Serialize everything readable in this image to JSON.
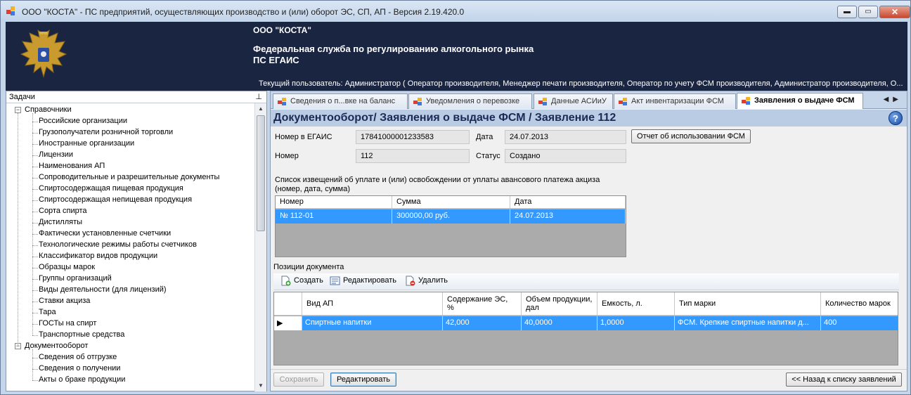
{
  "window": {
    "title": "ООО \"КОСТА\" - ПС предприятий, осуществляющих производство и (или) оборот ЭС, СП, АП - Версия 2.19.420.0",
    "minimize": "▬",
    "restore": "▭",
    "close": "✕"
  },
  "header": {
    "org": "ООО \"КОСТА\"",
    "federal": "Федеральная служба по регулированию алкогольного рынка",
    "system": "ПС ЕГАИС",
    "user": "Текущий пользователь: Администратор ( Оператор производителя, Менеджер печати производителя, Оператор по учету ФСМ производителя, Администратор производителя, О..."
  },
  "tasks": {
    "title": "Задачи",
    "pin": "⊥",
    "groups": [
      {
        "label": "Справочники",
        "expander": "−",
        "items": [
          "Российские организации",
          "Грузополучатели розничной торговли",
          "Иностранные организации",
          "Лицензии",
          "Наименования АП",
          "Сопроводительные и разрешительные документы",
          "Спиртосодержащая пищевая продукция",
          "Спиртосодержащая непищевая продукция",
          "Сорта спирта",
          "Дистилляты",
          "Фактически установленные счетчики",
          "Технологические режимы работы счетчиков",
          "Классификатор видов продукции",
          "Образцы марок",
          "Группы организаций",
          "Виды деятельности (для лицензий)",
          "Ставки акциза",
          "Тара",
          "ГОСТы на спирт",
          "Транспортные средства"
        ]
      },
      {
        "label": "Документооборот",
        "expander": "−",
        "items": [
          "Сведения об отгрузке",
          "Сведения о получении",
          "Акты о браке продукции"
        ]
      }
    ]
  },
  "tabs": [
    {
      "label": "Сведения о п...вке на баланс",
      "active": false
    },
    {
      "label": "Уведомления о перевозке",
      "active": false
    },
    {
      "label": "Данные АСИиУ",
      "active": false
    },
    {
      "label": "Акт инвентаризации ФСМ",
      "active": false
    },
    {
      "label": "Заявления о выдаче ФСМ",
      "active": true
    }
  ],
  "tab_arrows": "◀▶",
  "doc": {
    "title": "Документооборот/ Заявления о выдаче ФСМ / Заявление 112",
    "help": "?",
    "egais_label": "Номер в ЕГАИС",
    "egais_value": "17841000001233583",
    "date_label": "Дата",
    "date_value": "24.07.2013",
    "number_label": "Номер",
    "number_value": "112",
    "status_label": "Статус",
    "status_value": "Создано",
    "report_button": "Отчет об использовании ФСМ",
    "notices_label_1": "Список извещений об уплате и (или) освобождении от уплаты авансового платежа акциза",
    "notices_label_2": "(номер, дата, сумма)",
    "notices": {
      "columns": [
        "Номер",
        "Сумма",
        "Дата"
      ],
      "rows": [
        [
          "№ 112-01",
          "300000,00 руб.",
          "24.07.2013"
        ]
      ]
    },
    "positions_label": "Позиции документа",
    "toolbar": {
      "create": "Создать",
      "edit": "Редактировать",
      "delete": "Удалить"
    },
    "positions": {
      "columns": [
        "Вид АП",
        "Содержание ЭС,\n%",
        "Объем продукции,\nдал",
        "Емкость, л.",
        "Тип марки",
        "Количество марок"
      ],
      "rows": [
        [
          "Спиртные напитки",
          "42,000",
          "40,0000",
          "1,0000",
          "ФСМ. Крепкие спиртные напитки д...",
          "400"
        ]
      ],
      "row_marker": "▶"
    },
    "save_button": "Сохранить",
    "edit_button": "Редактировать",
    "back_button": "<< Назад к списку заявлений"
  }
}
